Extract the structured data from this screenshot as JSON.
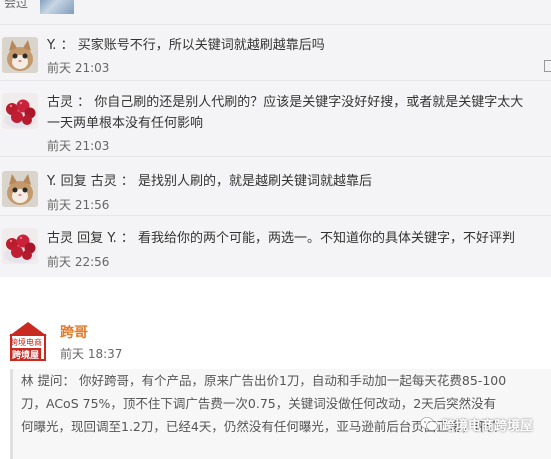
{
  "thread": {
    "top_label": "会过",
    "replies": [
      {
        "user": "Y. ：",
        "reply_word": "",
        "target": "",
        "text": "买家账号不行，所以关键词就越刷越靠后吗",
        "time": "前天 21:03",
        "avatar": "kitten-avatar"
      },
      {
        "user": "古灵 ：",
        "reply_word": "",
        "target": "",
        "text": "你自己刷的还是别人代刷的？应该是关键字没好好搜，或者就是关键字太大",
        "text2": "一天两单根本没有任何影响",
        "time": "前天 21:03",
        "avatar": "berries-avatar"
      },
      {
        "user": "Y.",
        "reply_word": "回复",
        "target": "古灵 ：",
        "text": "是找别人刷的，就是越刷关键词就越靠后",
        "time": "前天 21:56",
        "avatar": "kitten-avatar"
      },
      {
        "user": "古灵",
        "reply_word": "回复",
        "target": "Y. ：",
        "text": "看我给你的两个可能，两选一。不知道你的具体关键字，不好评判",
        "time": "前天 22:56",
        "avatar": "berries-avatar"
      }
    ]
  },
  "post": {
    "logo_line1": "跨境电商",
    "logo_line2": "跨境屋",
    "author": "跨哥",
    "time": "前天 18:37",
    "quote_lines": [
      "林 提问： 你好跨哥，有个产品，原来广告出价1刀，自动和手动加一起每天花费85-100",
      "刀，ACoS 75%，顶不住下调广告费一次0.75，关键词没做任何改动，2天后突然没有",
      "何曝光，现回调至1.2刀，已经4天，仍然没有任何曝光，亚马逊前后台页面正常，评价"
    ]
  },
  "watermark": "跨境电商跨境屋",
  "colors": {
    "thread_bg": "#f4f4f6",
    "author_orange": "#e27a2a",
    "logo_red": "#c82a22"
  }
}
